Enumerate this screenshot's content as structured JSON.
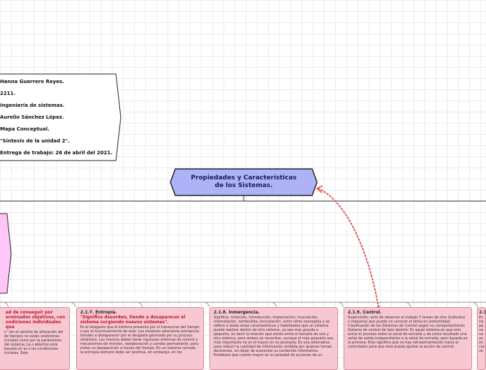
{
  "info": {
    "lines": [
      "Hanna Guerrero Reyes.",
      "2211.",
      "Ingeniería de sistemas.",
      "Aurelio Sánchez López.",
      "Mapa Conceptual.",
      "\"Síntesis de la unidad 2\".",
      "Entrega de trabajo: 26 de abril del 2021."
    ]
  },
  "central": {
    "label": "Propiedades y Características de los Sistemas."
  },
  "cards": [
    {
      "title": "",
      "subtitle": "ad de conseguir por erminados objetivos, con ondiciones individuales que",
      "body": "s\" (en el sentido de alteración del de tiempo) no están ondiciones iniciales como por la parámetros del sistema. La s abiertos está basada en su s las condiciones iniciales. Este"
    },
    {
      "title": "2.1.7. Entropía.",
      "subtitle": "\"Significa desorden, tiende a desaparecer el sistema surgiendo nuevos sistemas\".",
      "body": "Es el desgaste que el sistema presenta por el transcurso del tiempo o por el funcionamiento de este. Los sistemas altamente entrópicos tienden a desaparecer por el desgaste generado por su proceso sistémico. Los mismos deben tener rigurosos sistemas de control y mecanismos de revisión, reelaboración y cambio permanente, para evitar su desaparición a través del tiempo. En un sistema cerrado la entropía siempre debe ser positiva, sin embargo, en los"
    },
    {
      "title": "2.1.8. Inmergencia.",
      "subtitle": "",
      "body": "Significa: inserción, introducción, implantación, inoculación, intercalación, zambullida, incrustación, entre otros conceptos y se refiere a todas estas características y habilidades que un sistema puede realizar dentro de otro sistema, ya sea más grande o pequeño, es decir la relación que existe entre el tamaño de uno y otro sistema, pero ambos se necesitan, aunque el más pequeño sea más importante no es el mayor en su jerarquía. Es una alternativa para reducir la cantidad de información recibida por quienes toman decisiones, sin dejar de aumentar su contenido informativo. Establece que cuanto mayor es la variedad de acciones de un"
    },
    {
      "title": "2.1.9. Control.",
      "subtitle": "",
      "body": "Supervisión: acto de observar el trabajo Y tareas de otro (individuo o máquina) que puede no conocer el tema en profundidad. Clasificación de los Sistemas de Control según su comportamiento: Sistema de control de lazo abierto: Es aquel sistema en que solo actúa el proceso sobre la señal de entrada y da como resultado una señal de salida independiente a la señal de entrada, pero basada en la primera. Esto significa que no hay retroalimentación hacia el controlador para que éste pueda ajustar la acción de control."
    },
    {
      "title": "2.1",
      "subtitle": "",
      "body": "Es sis pe va va so en cre se"
    }
  ],
  "colors": {
    "central_fill": "#aeb3f7",
    "card_fill": "#f7c7d2",
    "left_node_fill": "#ffc6f7",
    "subtitle_red": "#c0162a",
    "dotted_arrow": "#e05a5a"
  }
}
